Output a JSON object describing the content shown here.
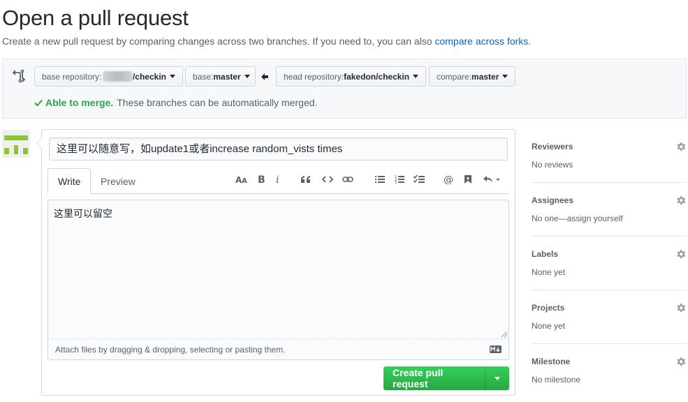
{
  "header": {
    "title": "Open a pull request",
    "subtitle_text": "Create a new pull request by comparing changes across two branches. If you need to, you can also ",
    "subtitle_link": "compare across forks",
    "subtitle_end": "."
  },
  "compare": {
    "base_repo_prefix": "base repository: ",
    "base_repo_value": "/checkin",
    "base_prefix": "base: ",
    "base_value": "master",
    "head_repo_prefix": "head repository: ",
    "head_repo_value": "fakedon/checkin",
    "compare_prefix": "compare: ",
    "compare_value": "master",
    "merge_ok": "Able to merge.",
    "merge_text": "These branches can be automatically merged."
  },
  "form": {
    "title_value": "这里可以随意写，如update1或者increase random_vists times",
    "tab_write": "Write",
    "tab_preview": "Preview",
    "body_value": "这里可以留空",
    "attach_text": "Attach files by dragging & dropping, selecting or pasting them.",
    "submit_label": "Create pull request"
  },
  "toolbar": {
    "icons": [
      "header-icon",
      "bold-icon",
      "italic-icon",
      "quote-icon",
      "code-icon",
      "link-icon",
      "unordered-list-icon",
      "ordered-list-icon",
      "task-list-icon",
      "mention-icon",
      "saved-reply-icon",
      "reply-icon"
    ]
  },
  "sidebar": {
    "reviewers": {
      "label": "Reviewers",
      "value": "No reviews"
    },
    "assignees": {
      "label": "Assignees",
      "value": "No one—assign yourself"
    },
    "labels": {
      "label": "Labels",
      "value": "None yet"
    },
    "projects": {
      "label": "Projects",
      "value": "None yet"
    },
    "milestone": {
      "label": "Milestone",
      "value": "No milestone"
    }
  },
  "colors": {
    "link": "#0366d6",
    "success": "#28a745",
    "avatar": "#8fc23d"
  }
}
